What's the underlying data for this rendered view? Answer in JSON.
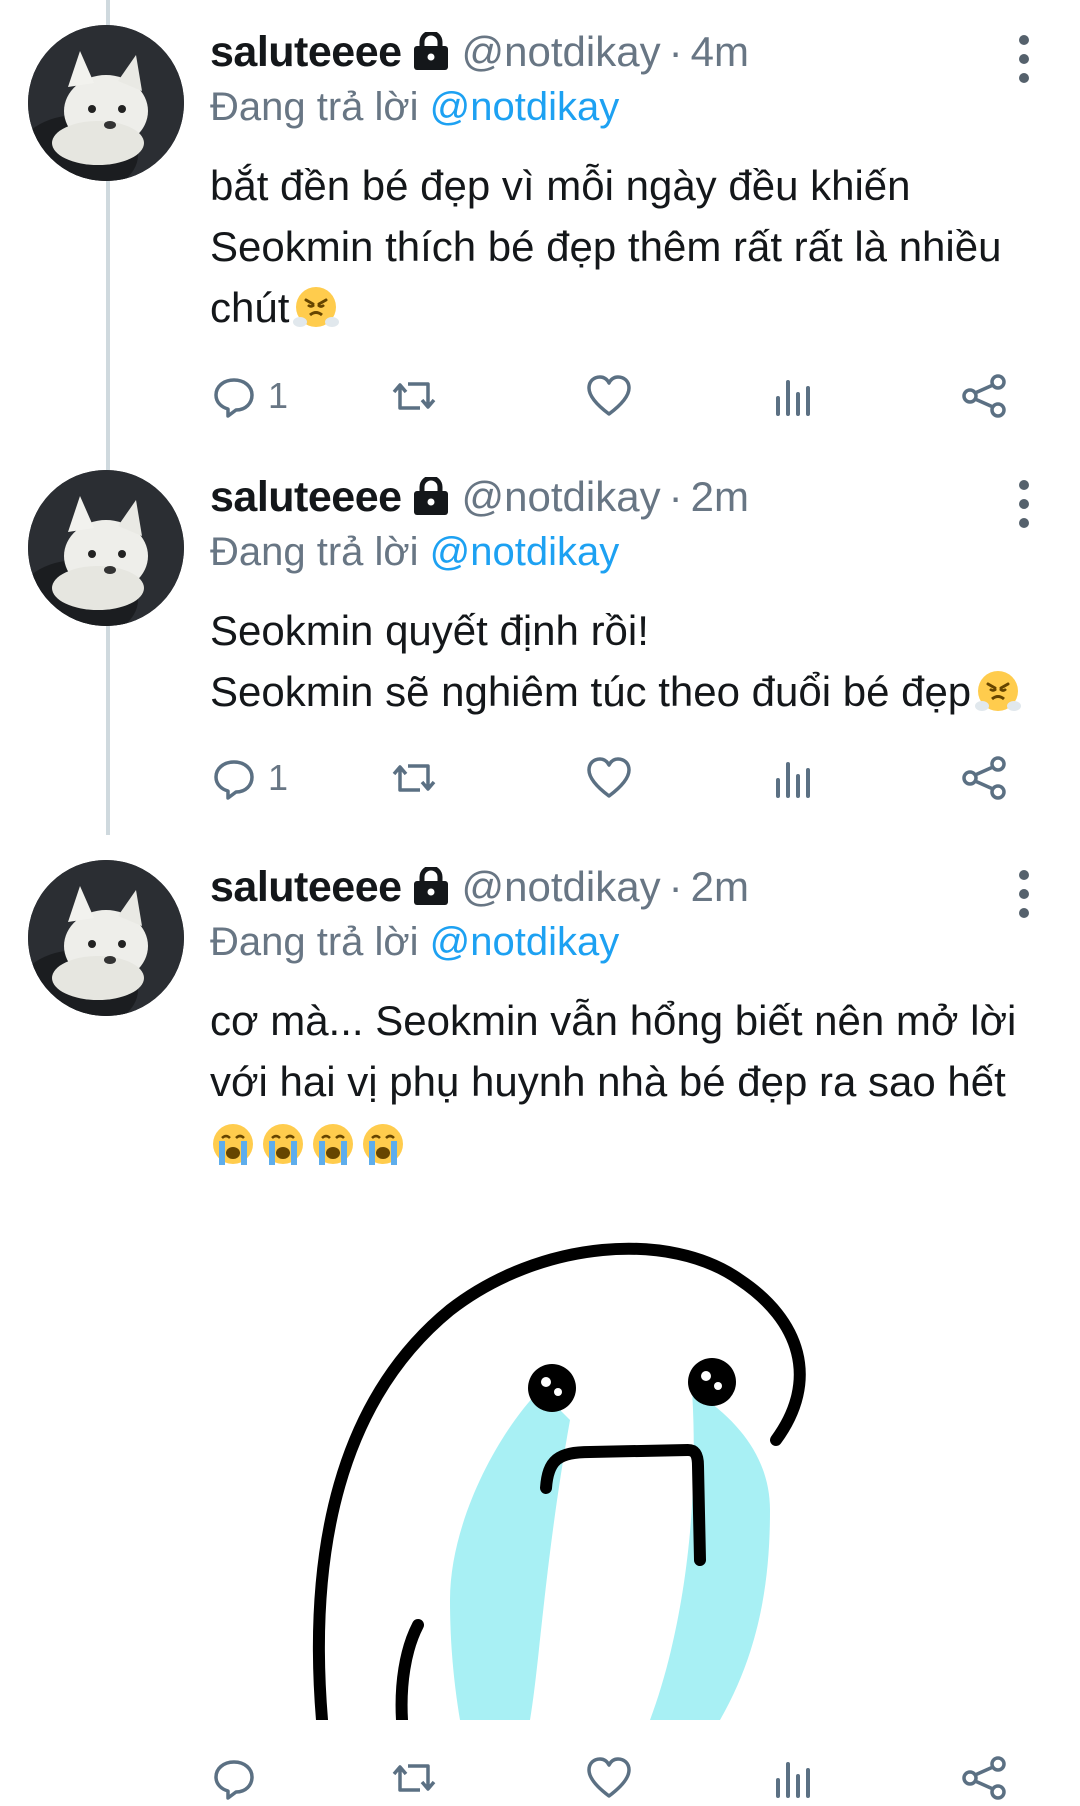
{
  "tweets": [
    {
      "username": "saluteeee",
      "handle": "@notdikay",
      "separator": "·",
      "time": "4m",
      "reply_prefix": "Đang trả lời",
      "reply_to": "@notdikay",
      "lines": [
        "bắt đền bé đẹp vì mỗi ngày đều khiến",
        "Seokmin thích bé đẹp thêm rất rất là nhiều",
        "chút"
      ],
      "emojis": [
        "face-with-steam-from-nose"
      ],
      "reply_count": "1"
    },
    {
      "username": "saluteeee",
      "handle": "@notdikay",
      "separator": "·",
      "time": "2m",
      "reply_prefix": "Đang trả lời",
      "reply_to": "@notdikay",
      "lines": [
        "Seokmin quyết định rồi!",
        "Seokmin sẽ nghiêm túc theo đuổi bé đẹp"
      ],
      "emojis": [
        "face-with-steam-from-nose"
      ],
      "reply_count": "1"
    },
    {
      "username": "saluteeee",
      "handle": "@notdikay",
      "separator": "·",
      "time": "2m",
      "reply_prefix": "Đang trả lời",
      "reply_to": "@notdikay",
      "lines": [
        "cơ mà... Seokmin vẫn hổng biết nên mở lời",
        "với hai vị phụ huynh nhà bé đẹp ra sao hết"
      ],
      "emojis": [
        "loudly-crying-face",
        "loudly-crying-face",
        "loudly-crying-face",
        "loudly-crying-face"
      ],
      "reply_count": "",
      "media": "crying-blob-sticker"
    }
  ],
  "colors": {
    "accent": "#1da1f2",
    "secondary_text": "#687684",
    "icon": "#5b7083",
    "tears": "#a8f0f4"
  },
  "icons": [
    "lock-icon",
    "more-icon",
    "reply-icon",
    "retweet-icon",
    "like-icon",
    "analytics-icon",
    "share-icon"
  ]
}
